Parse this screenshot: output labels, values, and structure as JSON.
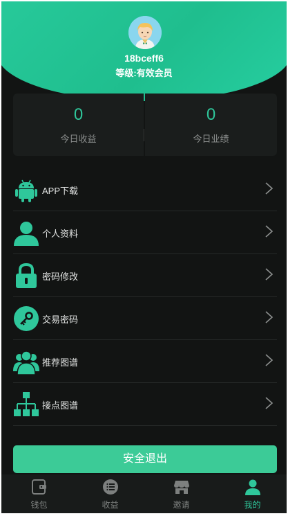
{
  "profile": {
    "username": "18bceff6",
    "level": "等级:有效会员"
  },
  "stats": [
    {
      "value": "0",
      "label": "今日收益"
    },
    {
      "value": "0",
      "label": "今日业绩"
    }
  ],
  "menu": [
    {
      "label": "APP下载",
      "icon": "android-icon"
    },
    {
      "label": "个人资料",
      "icon": "user-icon"
    },
    {
      "label": "密码修改",
      "icon": "lock-icon"
    },
    {
      "label": "交易密码",
      "icon": "key-icon"
    },
    {
      "label": "推荐图谱",
      "icon": "team-icon"
    },
    {
      "label": "接点图谱",
      "icon": "org-chart-icon"
    }
  ],
  "logout_label": "安全退出",
  "tabs": [
    {
      "label": "钱包",
      "icon": "wallet-icon",
      "active": false
    },
    {
      "label": "收益",
      "icon": "list-icon",
      "active": false
    },
    {
      "label": "邀请",
      "icon": "store-icon",
      "active": false
    },
    {
      "label": "我的",
      "icon": "person-icon",
      "active": true
    }
  ],
  "colors": {
    "accent": "#2fc79b",
    "background": "#121413",
    "card": "#1a1d1c",
    "tabbar": "#181b1a"
  }
}
